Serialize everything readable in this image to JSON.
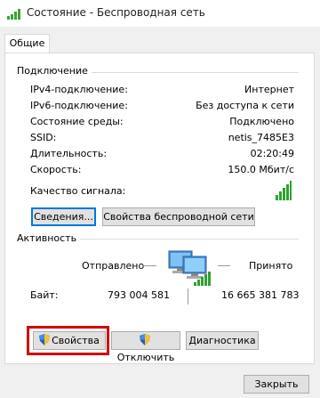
{
  "window": {
    "title": "Состояние - Беспроводная сеть",
    "icon": "wifi-signal-icon"
  },
  "tabs": [
    {
      "label": "Общие",
      "selected": true
    }
  ],
  "connection": {
    "group_title": "Подключение",
    "rows": [
      {
        "label": "IPv4-подключение:",
        "value": "Интернет"
      },
      {
        "label": "IPv6-подключение:",
        "value": "Без доступа к сети"
      },
      {
        "label": "Состояние среды:",
        "value": "Подключено"
      },
      {
        "label": "SSID:",
        "value": "netis_7485E3"
      },
      {
        "label": "Длительность:",
        "value": "02:20:49"
      },
      {
        "label": "Скорость:",
        "value": "150.0 Мбит/с"
      }
    ],
    "signal_label": "Качество сигнала:",
    "signal_level": "5 of 5 bars",
    "details_button": "Сведения...",
    "wireless_props_button": "Свойства беспроводной сети"
  },
  "activity": {
    "group_title": "Активность",
    "sent_label": "Отправлено",
    "received_label": "Принято",
    "bytes_label": "Байт:",
    "bytes_sent": "793 004 581",
    "bytes_received": "16 665 381 783",
    "icon": "network-computers-icon"
  },
  "actions": {
    "properties": "Свойства",
    "disconnect": "Отключить",
    "diagnostics": "Диагностика"
  },
  "footer": {
    "close": "Закрыть"
  },
  "colors": {
    "highlight": "#d40000",
    "signal_green": "#2fa12f",
    "focus_blue": "#0078d7"
  }
}
